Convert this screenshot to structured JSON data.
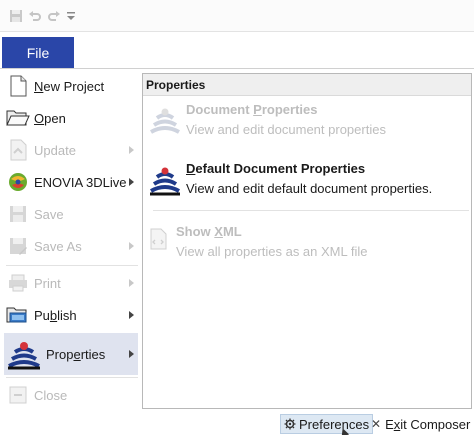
{
  "quick_access": {
    "items": [
      "save-icon",
      "undo-icon",
      "redo-icon",
      "customize-dropdown-icon"
    ]
  },
  "file_tab": {
    "label": "File"
  },
  "file_menu": {
    "items": [
      {
        "label": "New Project",
        "mnemonic": "N",
        "enabled": true,
        "submenu": false
      },
      {
        "label": "Open",
        "mnemonic": "O",
        "enabled": true,
        "submenu": false
      },
      {
        "label": "Update",
        "enabled": false,
        "submenu": true
      },
      {
        "label": "ENOVIA 3DLive",
        "enabled": true,
        "submenu": true
      },
      {
        "label": "Save",
        "enabled": false,
        "submenu": false
      },
      {
        "label": "Save As",
        "enabled": false,
        "submenu": true
      },
      {
        "label": "Print",
        "enabled": false,
        "submenu": true
      },
      {
        "label": "Publish",
        "enabled": true,
        "submenu": true
      },
      {
        "label": "Properties",
        "enabled": true,
        "submenu": true,
        "selected": true
      },
      {
        "label": "Close",
        "enabled": false,
        "submenu": false
      }
    ]
  },
  "properties_submenu": {
    "header": "Properties",
    "items": [
      {
        "title": "Document Properties",
        "description": "View and edit document properties",
        "enabled": false
      },
      {
        "title": "Default Document Properties",
        "description": "View and edit default document properties.",
        "enabled": true
      },
      {
        "title": "Show XML",
        "description": "View all properties as an XML file",
        "enabled": false
      }
    ]
  },
  "footer": {
    "preferences_label": "Preferences",
    "exit_label": "Exit Composer"
  },
  "colors": {
    "file_tab_bg": "#2a46a8",
    "selected_bg": "#dfe3ef",
    "disabled_text": "#b9b9b9"
  }
}
